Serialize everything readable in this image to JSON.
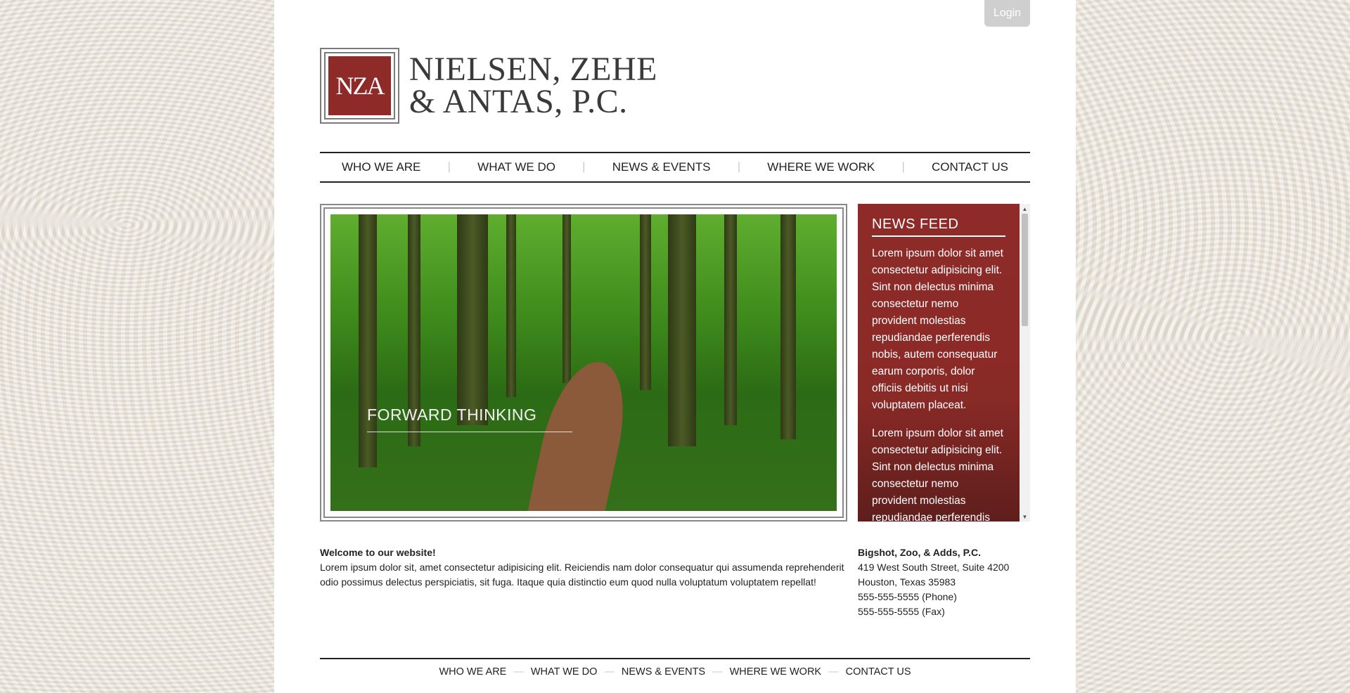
{
  "header": {
    "login_label": "Login",
    "logo": {
      "mark_text": "NZA",
      "name_line1": "NIELSEN, ZEHE",
      "name_line2": "& ANTAS, P.C."
    }
  },
  "nav": {
    "items": [
      {
        "label": "WHO WE ARE"
      },
      {
        "label": "WHAT WE DO"
      },
      {
        "label": "NEWS & EVENTS"
      },
      {
        "label": "WHERE WE WORK"
      },
      {
        "label": "CONTACT US"
      }
    ],
    "separator": "|"
  },
  "hero": {
    "caption": "FORWARD THINKING"
  },
  "news_feed": {
    "title": "NEWS FEED",
    "items": [
      {
        "text": "Lorem ipsum dolor sit amet consectetur adipisicing elit. Sint non delectus minima consectetur nemo provident molestias repudiandae perferendis nobis, autem consequatur earum corporis, dolor officiis debitis ut nisi voluptatem placeat."
      },
      {
        "text": "Lorem ipsum dolor sit amet consectetur adipisicing elit. Sint non delectus minima consectetur nemo provident molestias repudiandae perferendis nobis, autem consequatur earum corporis, dolor officiis debitis ut nisi voluptatem placeat."
      }
    ],
    "accent_color": "#8e2b28"
  },
  "welcome": {
    "title": "Welcome to our website!",
    "body": "Lorem ipsum dolor sit, amet consectetur adipisicing elit. Reiciendis nam dolor consequatur qui assumenda reprehenderit odio possimus delectus perspiciatis, sit fuga. Itaque quia distinctio eum quod nulla voluptatum voluptatem repellat!"
  },
  "address": {
    "name": "Bigshot, Zoo, & Adds, P.C.",
    "street": "419 West South Street, Suite 4200",
    "city": "Houston, Texas 35983",
    "phone": "555-555-5555 (Phone)",
    "fax": "555-555-5555 (Fax)"
  },
  "footer": {
    "items": [
      {
        "label": "WHO WE ARE"
      },
      {
        "label": "WHAT WE DO"
      },
      {
        "label": "NEWS & EVENTS"
      },
      {
        "label": "WHERE WE WORK"
      },
      {
        "label": "CONTACT US"
      }
    ],
    "separator": "—"
  }
}
